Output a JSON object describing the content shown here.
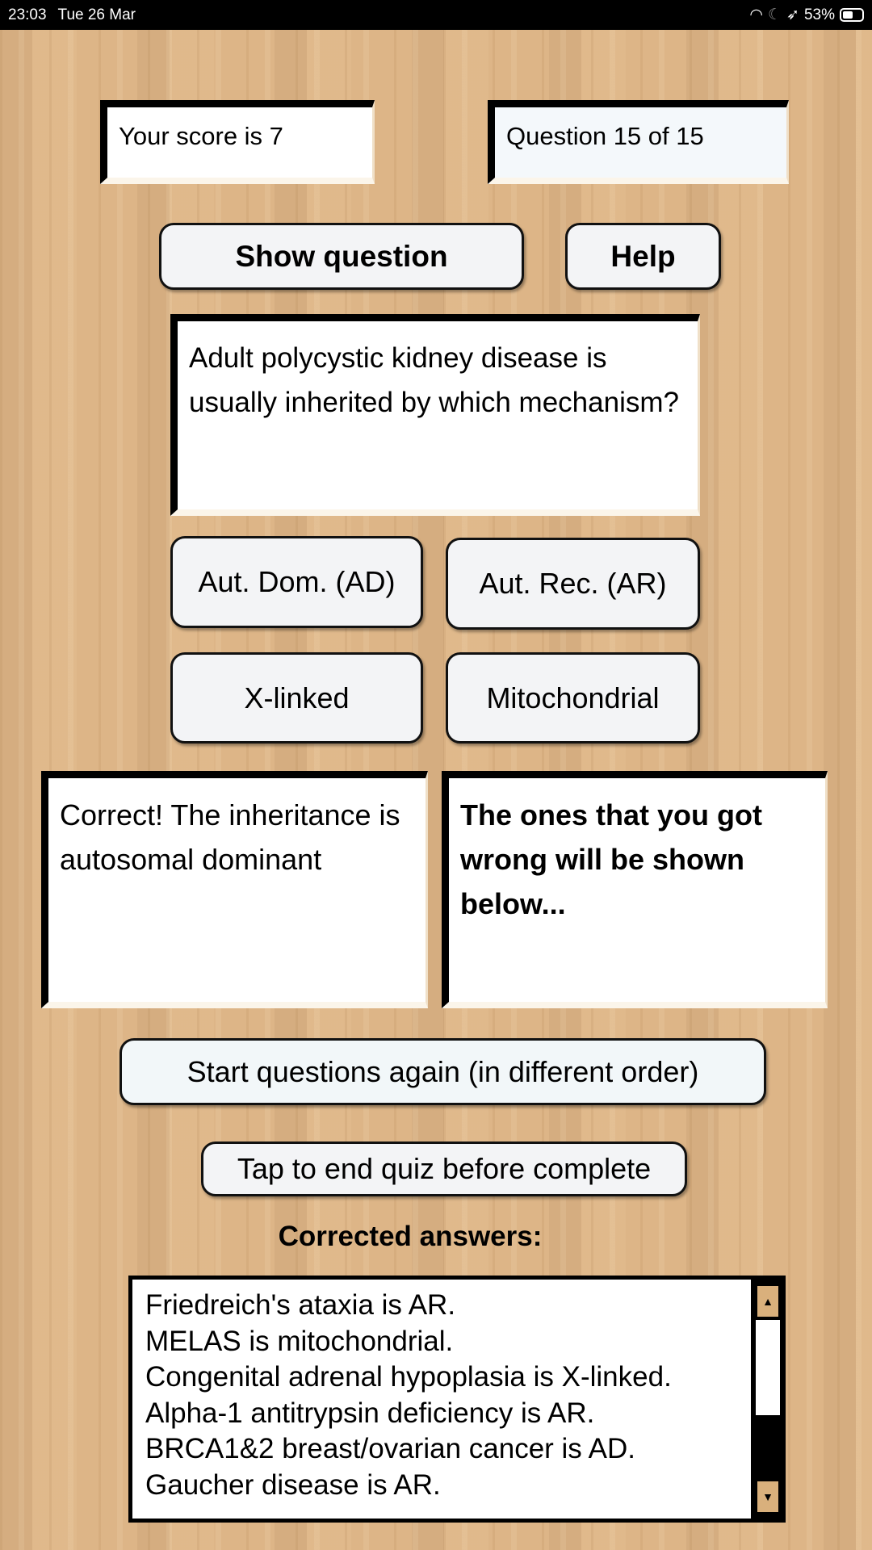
{
  "status_bar": {
    "time": "23:03",
    "date": "Tue 26 Mar",
    "battery": "53%",
    "battery_level": 0.53
  },
  "score": "Your score is 7",
  "progress": "Question 15 of 15",
  "buttons": {
    "show_question": "Show question",
    "help": "Help",
    "restart": "Start questions again (in different order)",
    "end_quiz": "Tap to end quiz before complete"
  },
  "question": "Adult polycystic kidney disease  is usually  inherited  by  which mechanism?",
  "answers": [
    "Aut. Dom. (AD)",
    "Aut. Rec. (AR)",
    "X-linked",
    "Mitochondrial"
  ],
  "feedback": "Correct! The inheritance is autosomal dominant",
  "info": "The ones that you got wrong will be shown below...",
  "corrected_label": "Corrected answers:",
  "corrected": [
    "Friedreich's ataxia  is AR.",
    "MELAS  is mitochondrial.",
    "Congenital adrenal hypoplasia  is X-linked.",
    "Alpha-1 antitrypsin deficiency  is AR.",
    "BRCA1&2 breast/ovarian cancer  is AD.",
    "Gaucher disease  is AR."
  ],
  "scrollbar": {
    "up": "▲",
    "down": "▼"
  }
}
